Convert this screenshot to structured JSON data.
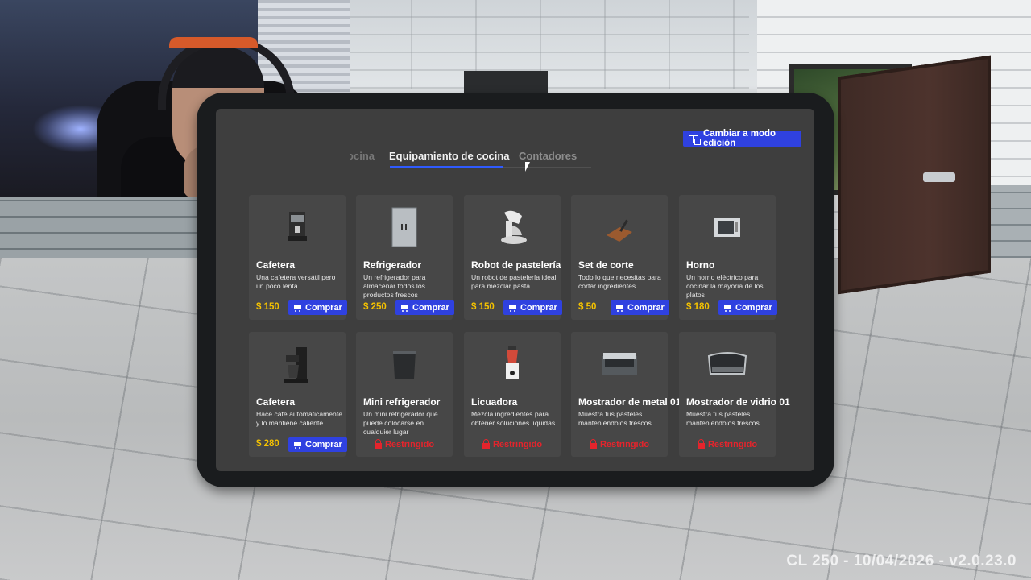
{
  "header": {
    "mode_button": "Cambiar a modo edición"
  },
  "tabs": {
    "partial": "ocina",
    "active": "Equipamiento de cocina",
    "inactive": "Contadores"
  },
  "products": [
    {
      "name": "Cafetera",
      "desc": "Una cafetera versátil pero un poco lenta",
      "price": "$ 150",
      "action": "Comprar",
      "image": "coffee-machine-icon"
    },
    {
      "name": "Refrigerador",
      "desc": "Un refrigerador para almacenar todos los productos frescos",
      "price": "$ 250",
      "action": "Comprar",
      "image": "fridge-icon"
    },
    {
      "name": "Robot de pastelería",
      "desc": "Un robot de pastelería ideal para mezclar pasta",
      "price": "$ 150",
      "action": "Comprar",
      "image": "stand-mixer-icon"
    },
    {
      "name": "Set de corte",
      "desc": "Todo lo que necesitas para cortar ingredientes",
      "price": "$ 50",
      "action": "Comprar",
      "image": "cutting-board-icon"
    },
    {
      "name": "Horno",
      "desc": "Un horno eléctrico para cocinar la mayoría de los platos",
      "price": "$ 180",
      "action": "Comprar",
      "image": "oven-icon"
    },
    {
      "name": "Cafetera",
      "desc": "Hace café automáticamente y lo mantiene caliente",
      "price": "$ 280",
      "action": "Comprar",
      "image": "drip-coffee-maker-icon"
    },
    {
      "name": "Mini refrigerador",
      "desc": "Un mini refrigerador que puede colocarse en cualquier lugar",
      "restricted": "Restringido",
      "image": "mini-fridge-icon"
    },
    {
      "name": "Licuadora",
      "desc": "Mezcla ingredientes para obtener soluciones líquidas",
      "restricted": "Restringido",
      "image": "blender-icon"
    },
    {
      "name": "Mostrador de metal 01",
      "desc": "Muestra tus pasteles manteniéndolos frescos",
      "restricted": "Restringido",
      "image": "metal-display-counter-icon"
    },
    {
      "name": "Mostrador de vidrio 01",
      "desc": "Muestra tus pasteles manteniéndolos frescos",
      "restricted": "Restringido",
      "image": "glass-display-counter-icon"
    }
  ],
  "footer": {
    "version": "CL 250 - 10/04/2026 - v2.0.23.0"
  },
  "colors": {
    "accent": "#2f41e0",
    "price": "#f5c200",
    "restricted": "#e4242c",
    "active_tab_underline": "#2f5bff"
  }
}
